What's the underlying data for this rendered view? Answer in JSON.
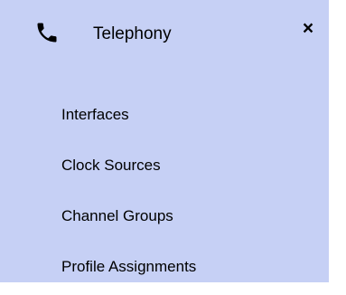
{
  "panel": {
    "title": "Telephony",
    "icon": "phone-icon",
    "close_label": "×",
    "colors": {
      "background": "#c6d0f5",
      "text": "#000000"
    }
  },
  "menu": {
    "items": [
      {
        "label": "Interfaces"
      },
      {
        "label": "Clock Sources"
      },
      {
        "label": "Channel Groups"
      },
      {
        "label": "Profile Assignments"
      }
    ]
  }
}
